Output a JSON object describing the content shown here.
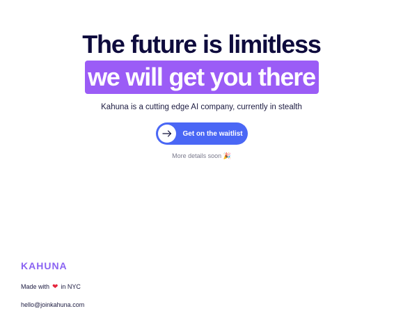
{
  "hero": {
    "headline": "The future is limitless",
    "highlight": "we will get you there",
    "tagline": "Kahuna is a cutting edge AI company, currently in stealth",
    "cta_label": "Get on the waitlist",
    "details": "More details soon",
    "details_emoji": "🎉"
  },
  "footer": {
    "brand": "KAHUNA",
    "made_with_prefix": "Made with",
    "heart": "❤",
    "made_with_suffix": "in NYC",
    "email": "hello@joinkahuna.com"
  },
  "colors": {
    "highlight_bg": "#9b5cf6",
    "cta_bg": "#4a67f5",
    "headline": "#0e0b3d",
    "brand": "#8a63f2",
    "heart": "#e5243b"
  },
  "icons": {
    "cta_icon": "arrow-right-icon"
  }
}
